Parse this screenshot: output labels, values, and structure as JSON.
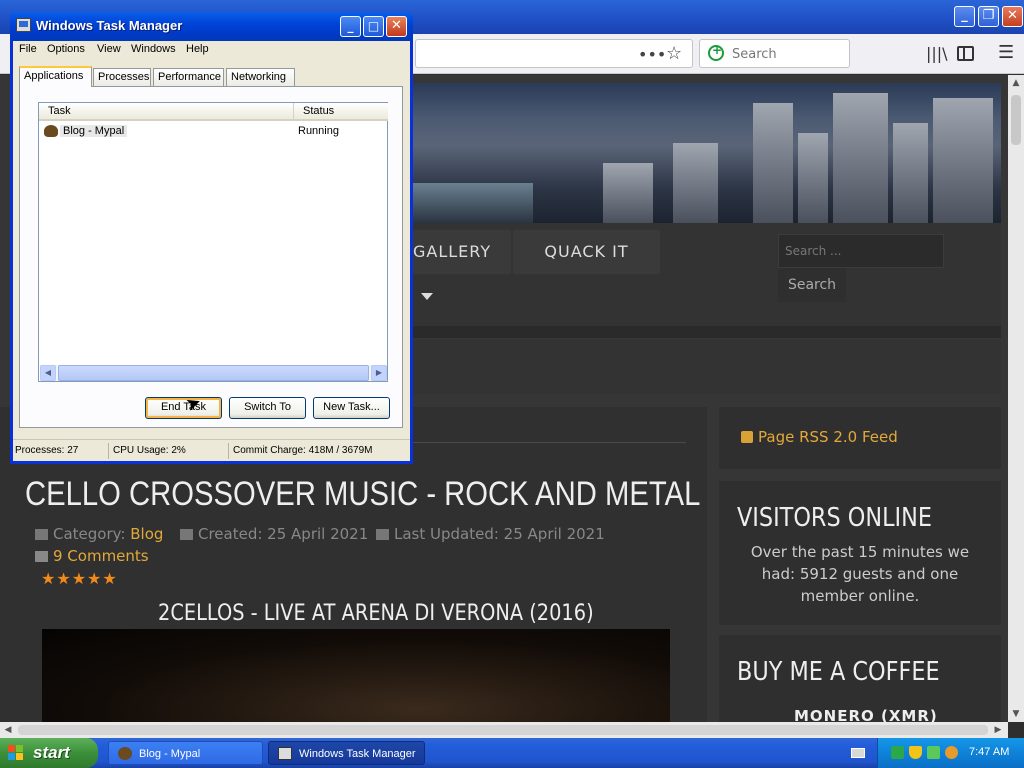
{
  "browser": {
    "search_placeholder": "Search",
    "url_dots": "•••",
    "star": "☆",
    "library_glyph": "|||\\",
    "menu_glyph": "☰",
    "minimize": "_",
    "maximize": "❐",
    "close": "✕"
  },
  "webpage": {
    "nav": {
      "gallery": "GALLERY",
      "quack": "QUACK IT"
    },
    "site_search": {
      "placeholder": "Search ...",
      "button": "Search"
    },
    "article": {
      "title": "CELLO CROSSOVER MUSIC - ROCK AND METAL",
      "category_label": "Category:",
      "category_value": "Blog",
      "created": "Created: 25 April 2021",
      "updated": "Last Updated: 25 April 2021",
      "comments": "9 Comments",
      "rating_stars": "★★★★★",
      "video_title": "2CELLOS - LIVE AT ARENA DI VERONA (2016)"
    },
    "sidebar": {
      "rss": "Page RSS 2.0 Feed",
      "visitors_title": "VISITORS ONLINE",
      "visitors_text": "Over the past 15 minutes we had: 5912 guests and one member online.",
      "coffee_title": "BUY ME A COFFEE",
      "monero": "MONERO (XMR)"
    }
  },
  "task_manager": {
    "title": "Windows Task Manager",
    "min": "_",
    "max": "□",
    "close": "✕",
    "menu": [
      "File",
      "Options",
      "View",
      "Windows",
      "Help"
    ],
    "tabs": [
      "Applications",
      "Processes",
      "Performance",
      "Networking"
    ],
    "active_tab": "Applications",
    "columns": {
      "task": "Task",
      "status": "Status"
    },
    "rows": [
      {
        "task": "Blog - Mypal",
        "status": "Running"
      }
    ],
    "buttons": {
      "end": "End Task",
      "switch": "Switch To",
      "new": "New Task..."
    },
    "status_bar": {
      "processes": "Processes: 27",
      "cpu": "CPU Usage: 2%",
      "commit": "Commit Charge: 418M / 3679M"
    }
  },
  "taskbar": {
    "start": "start",
    "tasks": [
      {
        "label": "Blog - Mypal",
        "active": false
      },
      {
        "label": "Windows Task Manager",
        "active": true
      }
    ],
    "clock": "7:47 AM"
  }
}
